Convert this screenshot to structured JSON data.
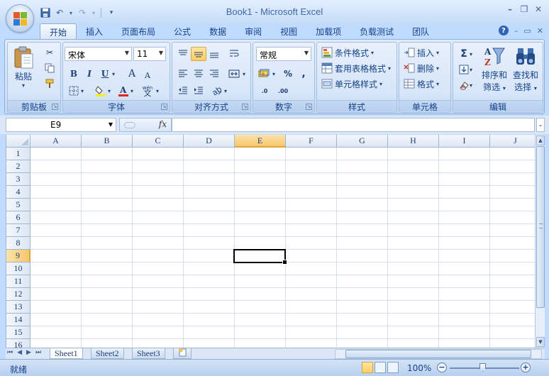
{
  "window": {
    "title": "Book1 - Microsoft Excel",
    "controls": [
      "–",
      "❐",
      "✕"
    ]
  },
  "quick_access": {
    "icons": [
      "save-icon",
      "undo-icon",
      "redo-icon",
      "customize-icon"
    ]
  },
  "ribbon_tabs": [
    {
      "label": "开始",
      "active": true
    },
    {
      "label": "插入"
    },
    {
      "label": "页面布局"
    },
    {
      "label": "公式"
    },
    {
      "label": "数据"
    },
    {
      "label": "审阅"
    },
    {
      "label": "视图"
    },
    {
      "label": "加载项"
    },
    {
      "label": "负载测试"
    },
    {
      "label": "团队"
    }
  ],
  "ribbon_right": {
    "help": "?",
    "min": "–",
    "restore": "▭",
    "close": "✕"
  },
  "groups": {
    "clipboard": {
      "label": "剪贴板",
      "paste": "粘贴"
    },
    "font": {
      "label": "字体",
      "font_name": "宋体",
      "font_size": "11",
      "bold": "B",
      "italic": "I",
      "underline": "U",
      "grow": "A",
      "shrink": "A",
      "wen": "wén"
    },
    "alignment": {
      "label": "对齐方式"
    },
    "number": {
      "label": "数字",
      "format": "常规",
      "percent": "%",
      "comma": ",",
      "inc": ".0",
      "dec": ".00"
    },
    "styles": {
      "label": "样式",
      "conditional": "条件格式",
      "table": "套用表格格式",
      "cell_styles": "单元格样式"
    },
    "cells": {
      "label": "单元格",
      "insert": "插入",
      "delete": "删除",
      "format": "格式"
    },
    "editing": {
      "label": "编辑",
      "sum": "Σ",
      "sort": "排序和",
      "sort2": "筛选",
      "find": "查找和",
      "find2": "选择"
    }
  },
  "formula_bar": {
    "name_box": "E9",
    "fx": "fx",
    "value": ""
  },
  "grid": {
    "columns": [
      "A",
      "B",
      "C",
      "D",
      "E",
      "F",
      "G",
      "H",
      "I",
      "J"
    ],
    "rows": [
      "1",
      "2",
      "3",
      "4",
      "5",
      "6",
      "7",
      "8",
      "9",
      "10",
      "11",
      "12",
      "13",
      "14",
      "15",
      "16"
    ],
    "selected_column": "E",
    "selected_row": "9"
  },
  "sheets": [
    {
      "label": "Sheet1",
      "active": true
    },
    {
      "label": "Sheet2"
    },
    {
      "label": "Sheet3"
    }
  ],
  "status": {
    "ready": "就绪",
    "zoom": "100%"
  },
  "colors": {
    "accent": "#15428b",
    "ribbon": "#d3e3f8",
    "selection": "#f6c76e"
  }
}
